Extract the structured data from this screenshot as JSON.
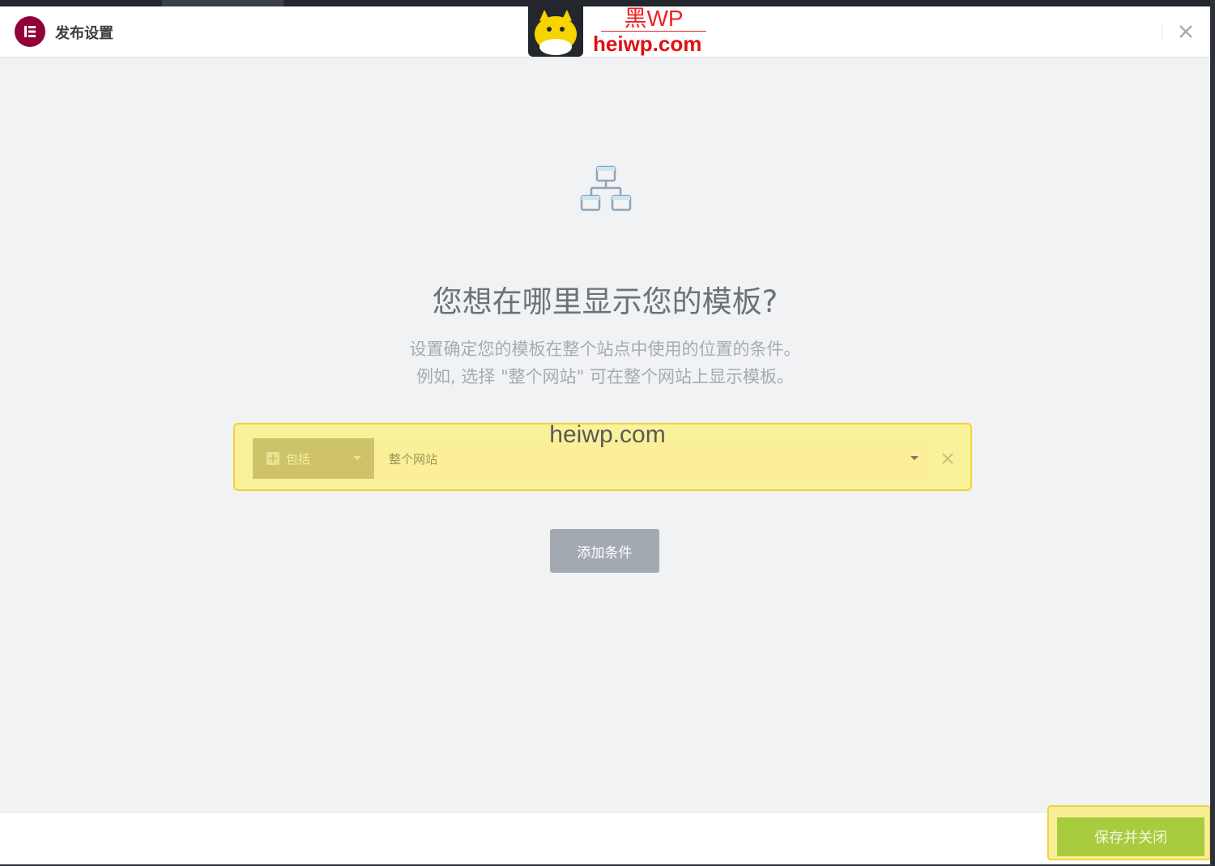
{
  "header": {
    "title": "发布设置",
    "close_icon": "close-icon",
    "logo_icon": "elementor-logo-icon"
  },
  "watermark": {
    "brand_cn": "黑WP",
    "brand_domain": "heiwp.com",
    "center_text": "heiwp.com"
  },
  "main": {
    "icon": "sitemap-icon",
    "title": "您想在哪里显示您的模板?",
    "description_line1": "设置确定您的模板在整个站点中使用的位置的条件。",
    "description_line2": "例如, 选择 \"整个网站\" 可在整个网站上显示模板。"
  },
  "condition": {
    "type_label": "包括",
    "target_label": "整个网站"
  },
  "actions": {
    "add_condition": "添加条件",
    "save_close": "保存并关闭"
  },
  "colors": {
    "brand": "#92003b",
    "highlight": "#f2d23c",
    "save_button": "#a9cc3f",
    "add_button": "#a3a9b0"
  }
}
